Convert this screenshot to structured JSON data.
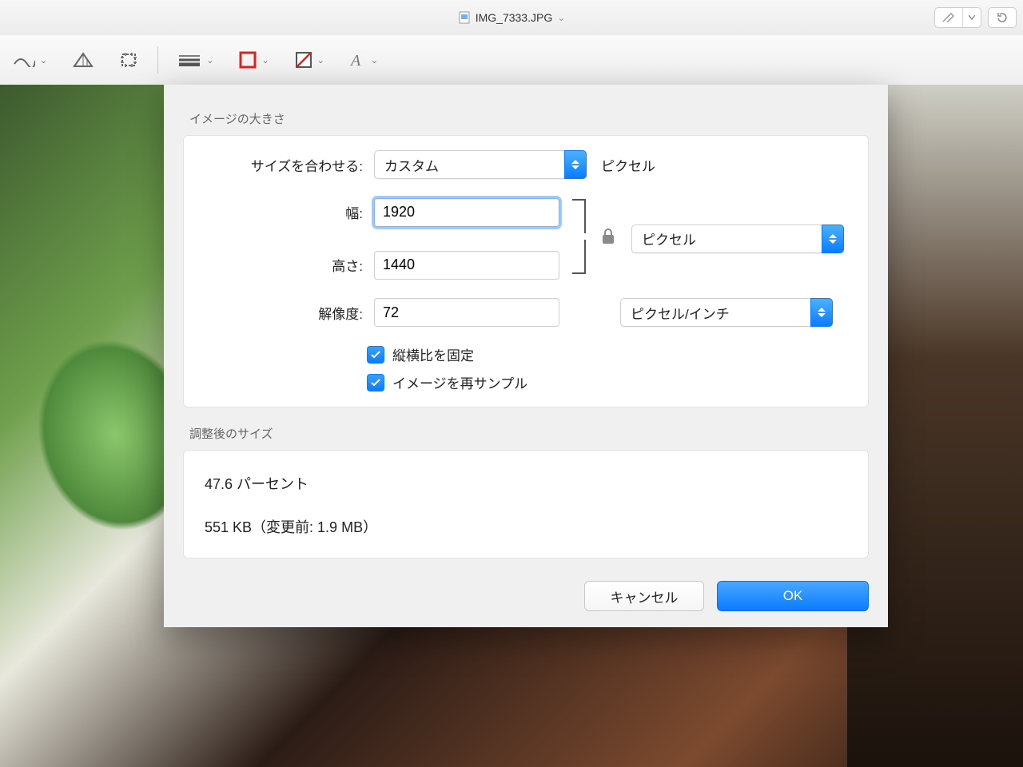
{
  "window": {
    "filename": "IMG_7333.JPG"
  },
  "dialog": {
    "section_image_size": "イメージの大きさ",
    "fit_label": "サイズを合わせる:",
    "fit_value": "カスタム",
    "fit_unit": "ピクセル",
    "width_label": "幅:",
    "width_value": "1920",
    "height_label": "高さ:",
    "height_value": "1440",
    "size_unit_value": "ピクセル",
    "resolution_label": "解像度:",
    "resolution_value": "72",
    "resolution_unit_value": "ピクセル/インチ",
    "check_aspect": "縦横比を固定",
    "check_resample": "イメージを再サンプル",
    "section_result": "調整後のサイズ",
    "result_percent": "47.6 パーセント",
    "result_size": "551 KB（変更前: 1.9 MB）",
    "cancel": "キャンセル",
    "ok": "OK"
  }
}
